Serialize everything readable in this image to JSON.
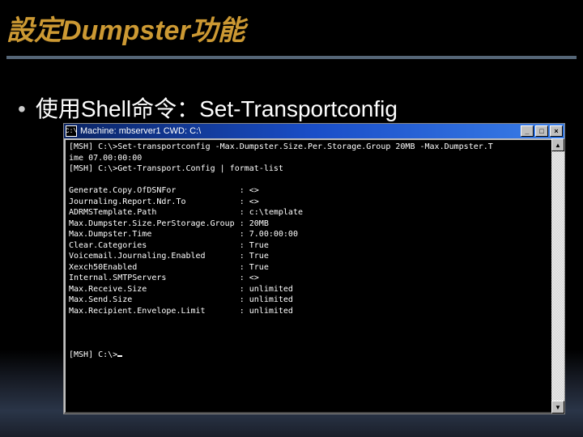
{
  "slide": {
    "title": "設定Dumpster功能",
    "bullet_prefix": "使用Shell命令：",
    "bullet_cmd": "Set-Transportconfig"
  },
  "window": {
    "title": "Machine: mbserver1 CWD: C:\\",
    "icon_glyph": "C:\\"
  },
  "buttons": {
    "minimize": "_",
    "maximize": "□",
    "close": "×"
  },
  "console": {
    "prompt": "[MSH] C:\\>",
    "cmd1": "Set-transportconfig -Max.Dumpster.Size.Per.Storage.Group 20MB -Max.Dumpster.T",
    "cmd1_wrap": "ime 07.00:00:00",
    "cmd2": "Get-Transport.Config | format-list",
    "config": [
      {
        "k": "Generate.Copy.OfDSNFor",
        "v": "<>"
      },
      {
        "k": "Journaling.Report.Ndr.To",
        "v": "<>"
      },
      {
        "k": "ADRMSTemplate.Path",
        "v": "c:\\template"
      },
      {
        "k": "Max.Dumpster.Size.PerStorage.Group",
        "v": "20MB"
      },
      {
        "k": "Max.Dumpster.Time",
        "v": "7.00:00:00"
      },
      {
        "k": "Clear.Categories",
        "v": "True"
      },
      {
        "k": "Voicemail.Journaling.Enabled",
        "v": "True"
      },
      {
        "k": "Xexch50Enabled",
        "v": "True"
      },
      {
        "k": "Internal.SMTPServers",
        "v": "<>"
      },
      {
        "k": "Max.Receive.Size",
        "v": "unlimited"
      },
      {
        "k": "Max.Send.Size",
        "v": "unlimited"
      },
      {
        "k": "Max.Recipient.Envelope.Limit",
        "v": "unlimited"
      }
    ],
    "final_prompt": "[MSH] C:\\>"
  },
  "scrollbar": {
    "up": "▲",
    "down": "▼"
  }
}
